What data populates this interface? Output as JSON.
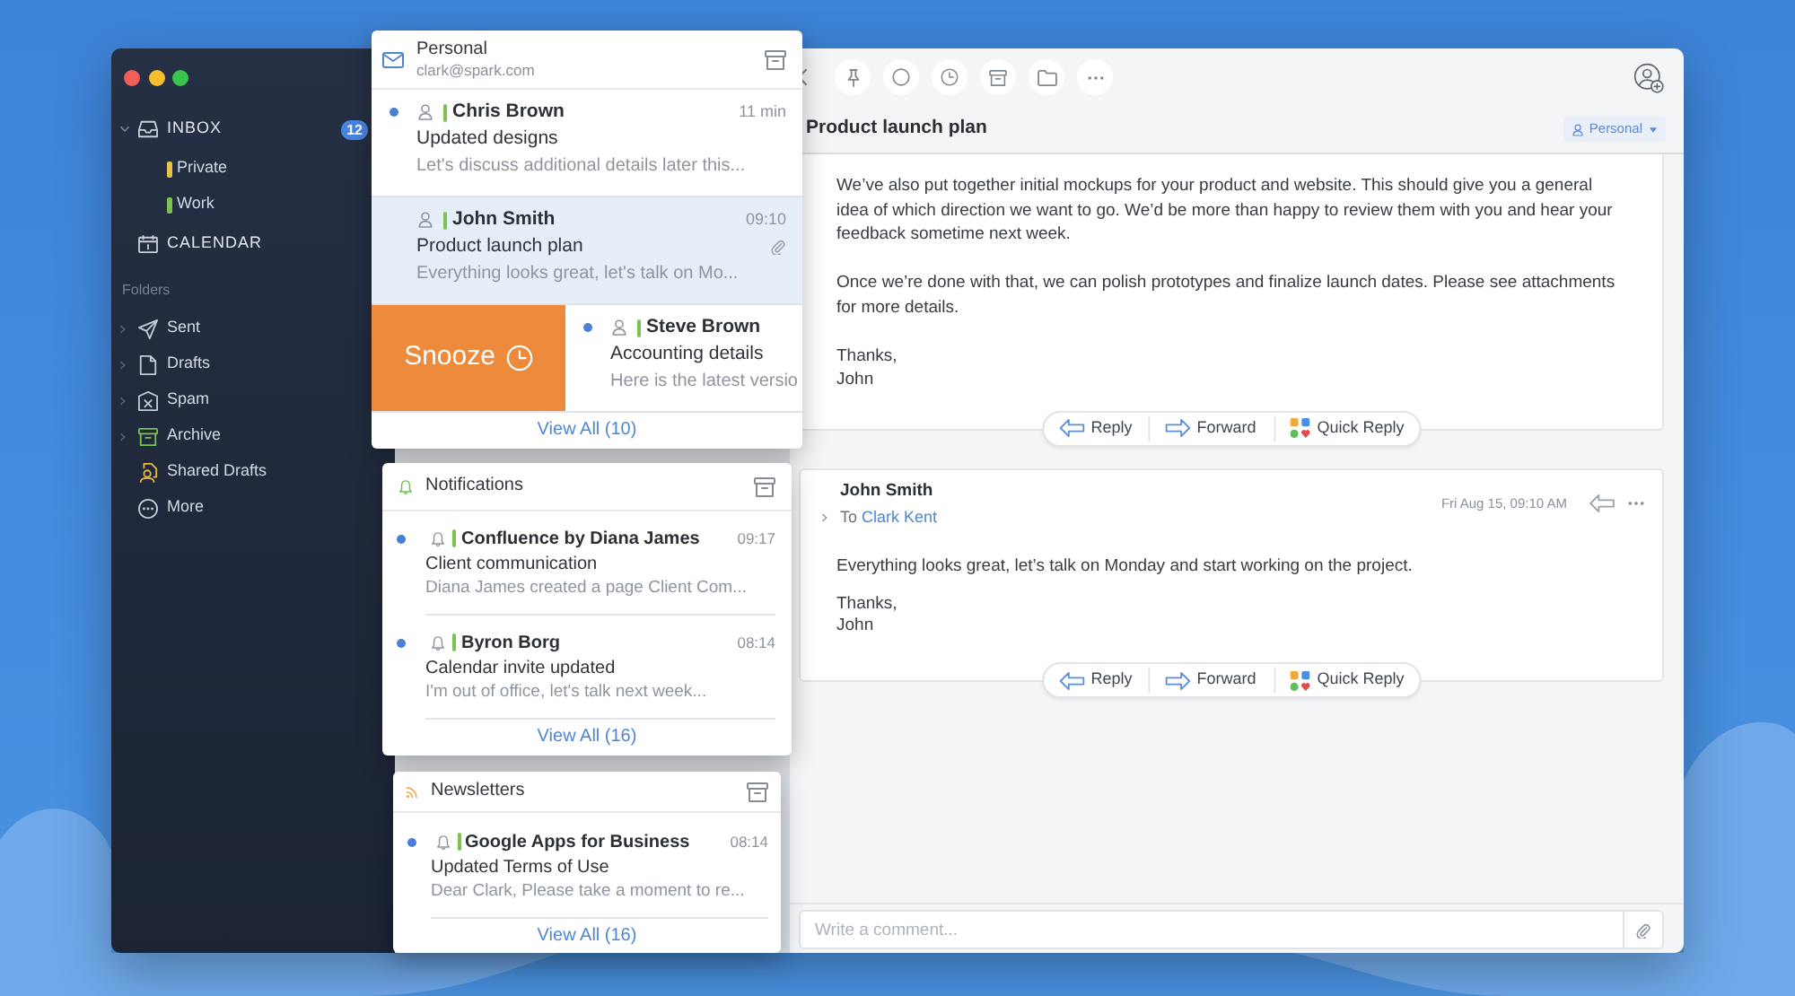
{
  "sidebar": {
    "mailboxes": [
      {
        "label": "INBOX",
        "badge": "12",
        "expanded": true,
        "children": [
          {
            "label": "Private",
            "color": "#e8c14a"
          },
          {
            "label": "Work",
            "color": "#7cc24f"
          }
        ]
      },
      {
        "label": "CALENDAR"
      }
    ],
    "folders_heading": "Folders",
    "folders": [
      {
        "label": "Sent",
        "expanded": false
      },
      {
        "label": "Drafts",
        "expanded": false
      },
      {
        "label": "Spam",
        "expanded": false
      },
      {
        "label": "Archive",
        "expanded": false
      },
      {
        "label": "Shared Drafts"
      },
      {
        "label": "More"
      }
    ]
  },
  "cards": [
    {
      "title": "Personal",
      "subtitle": "clark@spark.com",
      "messages": [
        {
          "kind": "person",
          "sender": "Chris Brown",
          "time": "11 min",
          "subject": "Updated designs",
          "preview": "Let's discuss additional details later this...",
          "unread": true,
          "selected": false,
          "attachment": false
        },
        {
          "kind": "person",
          "sender": "John Smith",
          "time": "09:10",
          "subject": "Product launch plan",
          "preview": "Everything looks great, let's talk on Mo...",
          "unread": false,
          "selected": true,
          "attachment": true
        },
        {
          "kind": "person",
          "sender": "Steve Brown",
          "subject": "Accounting details",
          "preview": "Here is the latest versio",
          "unread": true,
          "selected": false,
          "attachment": false,
          "swipe_action": "Snooze"
        }
      ],
      "view_all": "View All (10)"
    },
    {
      "title": "Notifications",
      "messages": [
        {
          "kind": "notification",
          "sender": "Confluence by Diana James",
          "time": "09:17",
          "subject": "Client communication",
          "preview": "Diana James created a page Client Com...",
          "unread": true,
          "selected": false,
          "attachment": false
        },
        {
          "kind": "notification",
          "sender": "Byron Borg",
          "time": "08:14",
          "subject": "Calendar invite updated",
          "preview": "I'm out of office, let's talk next week...",
          "unread": true,
          "selected": false,
          "attachment": false
        }
      ],
      "view_all": "View All (16)"
    },
    {
      "title": "Newsletters",
      "messages": [
        {
          "kind": "notification",
          "sender": "Google Apps for Business",
          "time": "08:14",
          "subject": "Updated Terms of Use",
          "preview": "Dear Clark, Please take a moment to re...",
          "unread": true,
          "selected": false,
          "attachment": false
        }
      ],
      "view_all": "View All (16)"
    }
  ],
  "reading_pane": {
    "title": "Product launch plan",
    "account_label": "Personal",
    "messages": [
      {
        "body": [
          "We’ve also put together initial mockups for your product and website. This should give you a general idea of which direction we want to go. We’d be more than happy to review them with you and hear your feedback sometime next week.",
          "Once we’re done with that, we can polish prototypes and finalize launch dates. Please see attachments for more details.",
          "Thanks,\nJohn"
        ],
        "actions": [
          "Reply",
          "Forward",
          "Quick Reply"
        ]
      },
      {
        "sender": "John Smith",
        "to_prefix": "To",
        "recipient": "Clark Kent",
        "date": "Fri Aug 15, 09:10 AM",
        "body": [
          "Everything looks great, let’s talk on Monday and start working on the project.",
          "Thanks,\nJohn"
        ],
        "actions": [
          "Reply",
          "Forward",
          "Quick Reply"
        ]
      }
    ],
    "comment": {
      "placeholder": "Write a comment..."
    }
  }
}
